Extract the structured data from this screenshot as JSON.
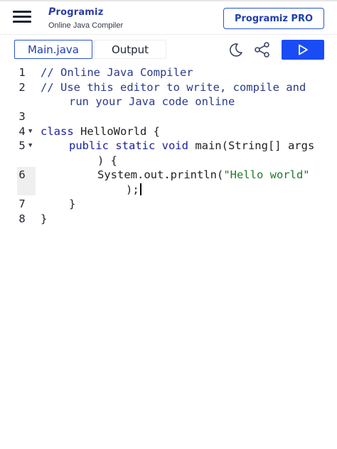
{
  "header": {
    "brand": "rogramiz",
    "brand_initial": "P",
    "subtitle": "Online Java Compiler",
    "pro_button": "Programiz PRO"
  },
  "tabs": [
    {
      "label": "Main.java",
      "active": true
    },
    {
      "label": "Output",
      "active": false
    }
  ],
  "toolbar": {
    "theme_icon": "moon-icon",
    "share_icon": "share-icon",
    "run_icon": "play-icon"
  },
  "colors": {
    "accent": "#2a55c9",
    "run_button": "#1a4cf5",
    "keyword": "#1a1fa0",
    "string": "#1f7a2b"
  },
  "editor": {
    "line_numbers": [
      "1",
      "2",
      "3",
      "4",
      "5",
      "6",
      "7",
      "8"
    ],
    "lines": {
      "l1": "// Online Java Compiler",
      "l2a": "// Use this editor to write, compile and",
      "l2b": "run your Java code online",
      "l4_kw": "class",
      "l4_rest": " HelloWorld {",
      "l5_kw": "public static void",
      "l5_rest": " main(String[] args",
      "l5b": ") {",
      "l6_obj": "System.out.println(",
      "l6_str": "\"Hello world\"",
      "l6b": ");",
      "l7": "}",
      "l8": "}"
    }
  }
}
